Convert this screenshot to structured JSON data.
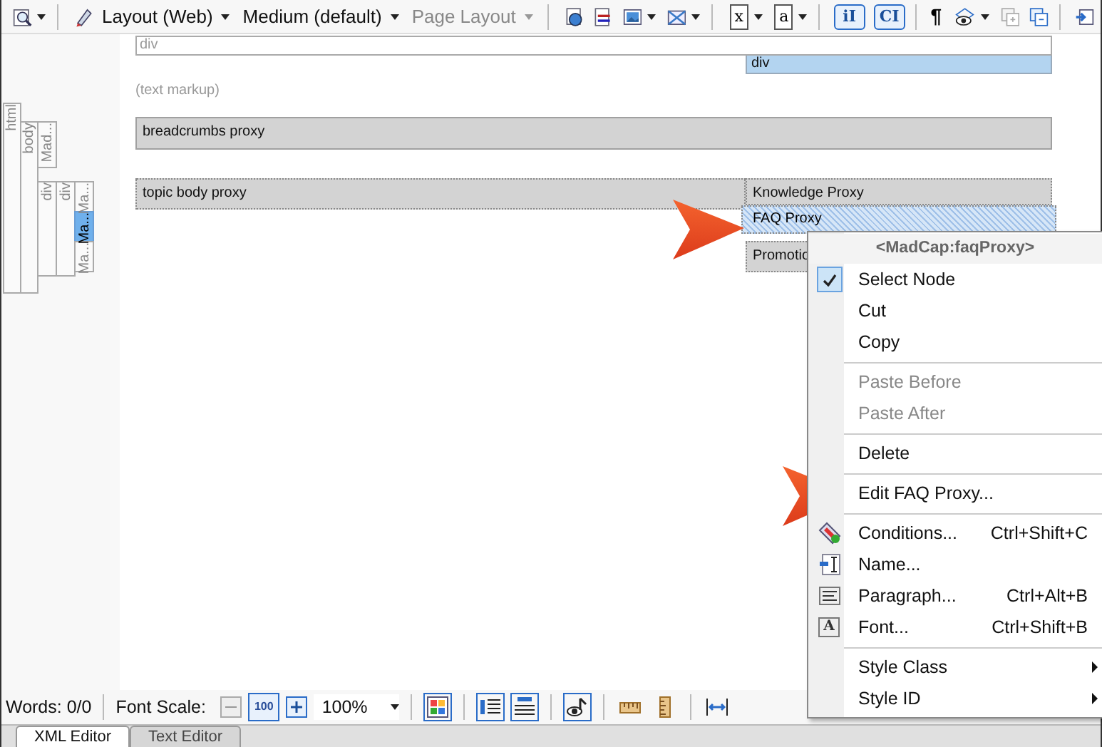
{
  "toolbar": [
    {
      "kind": "icon"
    },
    {
      "kind": "caret"
    },
    {
      "kind": "separator"
    },
    {
      "kind": "icon"
    },
    {
      "kind": "menu",
      "label": "Layout (Web)",
      "disabled": false
    },
    {
      "kind": "menu",
      "label": "Medium (default)",
      "disabled": false
    },
    {
      "kind": "menu",
      "label": "Page Layout",
      "disabled": true
    },
    {
      "kind": "separator"
    },
    {
      "kind": "icon"
    },
    {
      "kind": "icon"
    },
    {
      "kind": "icon"
    },
    {
      "kind": "caret"
    },
    {
      "kind": "icon"
    },
    {
      "kind": "caret"
    },
    {
      "kind": "separator"
    },
    {
      "kind": "glyph-page",
      "glyph": "x"
    },
    {
      "kind": "caret"
    },
    {
      "kind": "glyph-page",
      "glyph": "a"
    },
    {
      "kind": "caret"
    },
    {
      "kind": "separator"
    },
    {
      "kind": "glyph-box",
      "glyph": "iI"
    },
    {
      "kind": "glyph-box",
      "glyph": "CI"
    },
    {
      "kind": "separator"
    },
    {
      "kind": "glyph",
      "glyph": "¶"
    },
    {
      "kind": "icon"
    },
    {
      "kind": "caret"
    },
    {
      "kind": "icon"
    },
    {
      "kind": "icon"
    },
    {
      "kind": "separator"
    },
    {
      "kind": "icon"
    }
  ],
  "structure": {
    "html": "html",
    "body": "body",
    "madcap": "Mad...",
    "divs": [
      "div",
      "div"
    ],
    "proxies": [
      {
        "label": "Ma...",
        "selected": false
      },
      {
        "label": "Ma...",
        "selected": true
      },
      {
        "label": "Ma...",
        "selected": false
      }
    ]
  },
  "blocks": [
    {
      "kind": "outline",
      "label": "div"
    },
    {
      "kind": "highlight",
      "label": "div"
    },
    {
      "kind": "note",
      "label": "(text markup)"
    },
    {
      "kind": "proxy",
      "label": "breadcrumbs proxy"
    }
  ],
  "body_row": {
    "main": "topic body proxy",
    "side": [
      {
        "label": "Knowledge Proxy",
        "selected": false
      },
      {
        "label": "FAQ Proxy",
        "selected": true
      },
      {
        "label": "Promotio",
        "selected": false
      }
    ]
  },
  "context_menu": {
    "title": "<MadCap:faqProxy>",
    "items": [
      {
        "kind": "item",
        "label": "Select Node",
        "checked": true,
        "disabled": false,
        "submenu": false
      },
      {
        "kind": "item",
        "label": "Cut",
        "checked": false,
        "disabled": false,
        "submenu": false
      },
      {
        "kind": "item",
        "label": "Copy",
        "checked": false,
        "disabled": false,
        "submenu": false
      },
      {
        "kind": "separator"
      },
      {
        "kind": "item",
        "label": "Paste Before",
        "checked": false,
        "disabled": true,
        "submenu": false
      },
      {
        "kind": "item",
        "label": "Paste After",
        "checked": false,
        "disabled": true,
        "submenu": false
      },
      {
        "kind": "separator"
      },
      {
        "kind": "item",
        "label": "Delete",
        "checked": false,
        "disabled": false,
        "submenu": false
      },
      {
        "kind": "separator"
      },
      {
        "kind": "item",
        "label": "Edit FAQ Proxy...",
        "checked": false,
        "disabled": false,
        "submenu": false
      },
      {
        "kind": "separator"
      },
      {
        "kind": "item",
        "label": "Conditions...",
        "shortcut": "Ctrl+Shift+C",
        "checked": false,
        "disabled": false,
        "submenu": false
      },
      {
        "kind": "item",
        "label": "Name...",
        "checked": false,
        "disabled": false,
        "submenu": false
      },
      {
        "kind": "item",
        "label": "Paragraph...",
        "shortcut": "Ctrl+Alt+B",
        "checked": false,
        "disabled": false,
        "submenu": false
      },
      {
        "kind": "item",
        "label": "Font...",
        "shortcut": "Ctrl+Shift+B",
        "icon_label": "A",
        "checked": false,
        "disabled": false,
        "submenu": false
      },
      {
        "kind": "separator"
      },
      {
        "kind": "item",
        "label": "Style Class",
        "checked": false,
        "disabled": false,
        "submenu": true
      },
      {
        "kind": "item",
        "label": "Style ID",
        "checked": false,
        "disabled": false,
        "submenu": true
      }
    ]
  },
  "status_bar": {
    "words": "Words: 0/0",
    "font_scale_label": "Font Scale:",
    "scale_glyph": "100",
    "zoom": "100%"
  },
  "tabs": [
    {
      "label": "XML Editor",
      "selected": true
    },
    {
      "label": "Text Editor",
      "selected": false
    }
  ]
}
